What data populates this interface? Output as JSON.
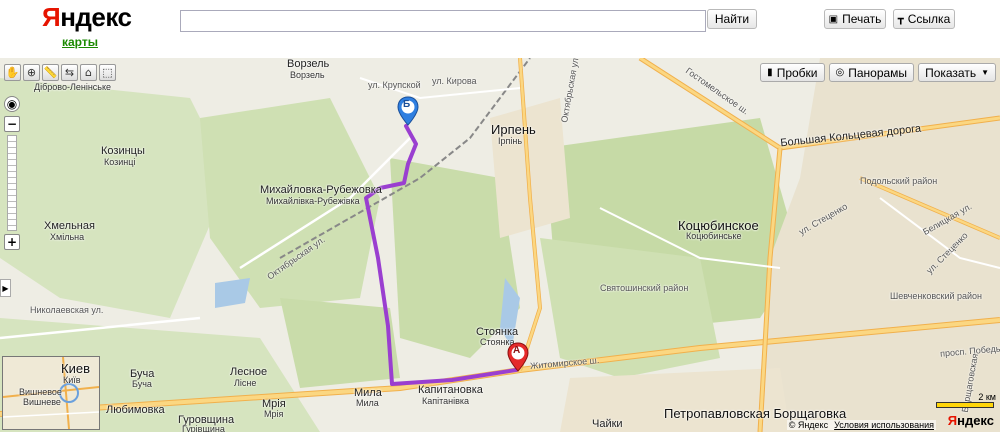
{
  "header": {
    "logo_first_letter": "Я",
    "logo_rest": "ндекс",
    "logo_sub": "карты",
    "search_value": "",
    "find_button": "Найти",
    "print_button": "Печать",
    "link_button": "Ссылка"
  },
  "map": {
    "layers": {
      "traffic": "Пробки",
      "panoramas": "Панорамы",
      "show": "Показать"
    },
    "labels": {
      "dibrovo": "Діброво-Ленінське",
      "vorzel": "Ворзель",
      "vorzel_ua": "Ворзель",
      "krupskoy": "ул. Крупской",
      "kirova": "ул. Кирова",
      "irpen": "Ирпень",
      "irpen_ua": "Ірпінь",
      "kozintsy": "Козинцы",
      "kozintsy_ua": "Козинці",
      "mikhailovka": "Михайловка-Рубежовка",
      "mikhailovka_ua": "Михайлівка-Рубежівка",
      "khmelnaya": "Хмельная",
      "khmelnaya_ua": "Хмільна",
      "oktyabrskaya": "Октябрьская ул.",
      "oktyabrskaya2": "Октябрьская ул.",
      "gostomel": "Гостомельское ш.",
      "bolshaya": "Большая Кольцевая дорога",
      "podolsky": "Подольский район",
      "kotsyubinskoe": "Коцюбинское",
      "kotsyubinskoe_ua": "Коцюбинське",
      "stetsenko": "ул. Стеценко",
      "stetsenko2": "ул. Стеценко",
      "belitskaya": "Белицкая ул.",
      "svyatoshinsky": "Святошинский район",
      "shevchenkovsky": "Шевченковский район",
      "nikolaevskaya": "Николаевская ул.",
      "stoyanka": "Стоянка",
      "stoyanka_ua": "Стоянка",
      "zhitomirskoe": "Житомирское ш.",
      "pobedy": "просп. Победы",
      "kievmini": "Киев",
      "kievmini_ua": "Київ",
      "vishnevoe": "Вишневое",
      "vishneve": "Вишневе",
      "bucha": "Буча",
      "bucha_ua": "Буча",
      "lesnoe": "Лесное",
      "lisne": "Лісне",
      "mila": "Мила",
      "mila_ua": "Мила",
      "kapitanovka": "Капитановка",
      "kapitanivka": "Капітанівка",
      "mriya": "Мрія",
      "mriya_ua": "Мрія",
      "lyubimovka": "Любимовка",
      "gurovshchina": "Гуровщина",
      "gurivshchina": "Гурівщина",
      "chaiki": "Чайки",
      "petropavlovskaya": "Петропавловская Борщаговка",
      "borshchagovskaya": "Борщаговская",
      "marker_a": "А",
      "marker_b": "Б"
    },
    "scale_label": "2 км",
    "copyright": "© Яндекс",
    "terms": "Условия использования",
    "map_logo_first": "Я",
    "map_logo_rest": "ндекс"
  },
  "colors": {
    "route": "#9a3fd0",
    "road_major": "#f5c46b",
    "forest": "#c9dcaa",
    "water": "#a9c9e6"
  }
}
